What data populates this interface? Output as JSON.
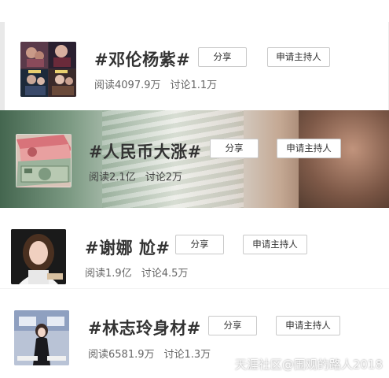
{
  "topics": [
    {
      "title": "#邓伦杨紫#",
      "reads": "阅读4097.9万",
      "comments": "讨论1.1万",
      "share_label": "分享",
      "host_label": "申请主持人",
      "thumb_icon": "collage-photo"
    },
    {
      "title": "#人民币大涨#",
      "reads": "阅读2.1亿",
      "comments": "讨论2万",
      "share_label": "分享",
      "host_label": "申请主持人",
      "thumb_icon": "banknotes-photo"
    },
    {
      "title": "#谢娜 尬#",
      "reads": "阅读1.9亿",
      "comments": "讨论4.5万",
      "share_label": "分享",
      "host_label": "申请主持人",
      "thumb_icon": "portrait-photo"
    },
    {
      "title": "#林志玲身材#",
      "reads": "阅读6581.9万",
      "comments": "讨论1.3万",
      "share_label": "分享",
      "host_label": "申请主持人",
      "thumb_icon": "poster-photo"
    }
  ],
  "watermark": "天涯社区@围观的路人2018",
  "colors": {
    "title": "#333333",
    "stats": "#666666",
    "button_border": "#c9c9c9"
  }
}
